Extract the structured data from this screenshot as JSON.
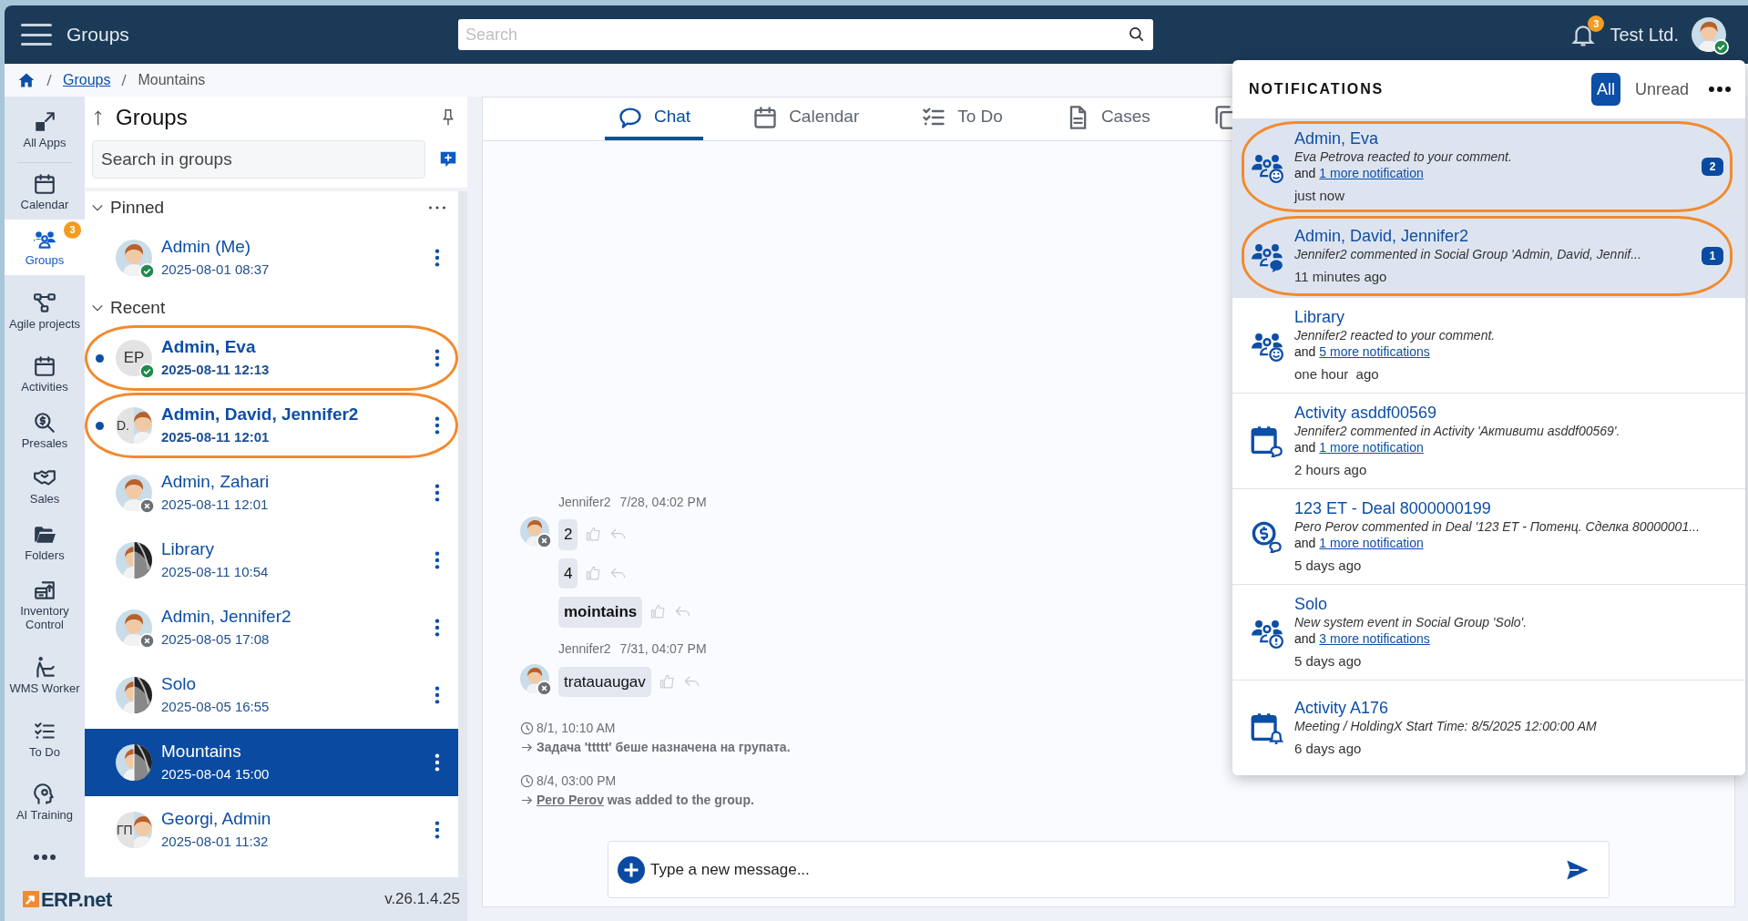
{
  "app_bar": {
    "title": "Groups",
    "search_placeholder": "Search",
    "notification_count": "3",
    "company": "Test Ltd.",
    "user_online": true
  },
  "breadcrumb": [
    {
      "kind": "home"
    },
    {
      "kind": "link",
      "label": "Groups"
    },
    {
      "kind": "current",
      "label": "Mountains"
    }
  ],
  "nav": [
    {
      "kind": "apps",
      "label": "All Apps",
      "selected": false
    },
    {
      "kind": "calendar",
      "label": "Calendar",
      "selected": false
    },
    {
      "kind": "groups",
      "label": "Groups",
      "selected": true,
      "badge": "3"
    },
    {
      "kind": "agile",
      "label": "Agile projects",
      "selected": false
    },
    {
      "kind": "calendar",
      "label": "Activities",
      "selected": false
    },
    {
      "kind": "presales",
      "label": "Presales",
      "selected": false
    },
    {
      "kind": "handshake",
      "label": "Sales",
      "selected": false
    },
    {
      "kind": "folder",
      "label": "Folders",
      "selected": false
    },
    {
      "kind": "inventory",
      "label": "Inventory Control",
      "selected": false
    },
    {
      "kind": "worker",
      "label": "WMS Worker",
      "selected": false
    },
    {
      "kind": "todo",
      "label": "To Do",
      "selected": false
    },
    {
      "kind": "ai",
      "label": "AI Training",
      "selected": false
    },
    {
      "kind": "more",
      "selected": false
    }
  ],
  "footer": {
    "logo": "ERP.net",
    "version": "v.26.1.4.25"
  },
  "groups_panel": {
    "title": "Groups",
    "search_placeholder": "Search in groups",
    "sections": [
      {
        "label": "Pinned",
        "expanded": true,
        "menu": true,
        "items": [
          {
            "name": "Admin (Me)",
            "time": "2025-08-01 08:37",
            "unread": false,
            "selected": false,
            "circled": false,
            "avatar": {
              "kind": "photo",
              "online": true
            }
          }
        ]
      },
      {
        "label": "Recent",
        "expanded": true,
        "items": [
          {
            "name": "Admin, Eva",
            "time": "2025-08-11 12:13",
            "unread": true,
            "selected": false,
            "circled": true,
            "avatar": {
              "kind": "initials",
              "initials": "EP",
              "online": true
            }
          },
          {
            "name": "Admin, David, Jennifer2",
            "time": "2025-08-11 12:01",
            "unread": true,
            "selected": false,
            "circled": true,
            "avatar": {
              "kind": "initials_photo",
              "initials": "D."
            }
          },
          {
            "name": "Admin, Zahari",
            "time": "2025-08-11 12:01",
            "unread": false,
            "selected": false,
            "circled": false,
            "avatar": {
              "kind": "photo",
              "online": false
            }
          },
          {
            "name": "Library",
            "time": "2025-08-11 10:54",
            "unread": false,
            "selected": false,
            "circled": false,
            "avatar": {
              "kind": "photo_pair"
            }
          },
          {
            "name": "Admin, Jennifer2",
            "time": "2025-08-05 17:08",
            "unread": false,
            "selected": false,
            "circled": false,
            "avatar": {
              "kind": "photo",
              "online": false
            }
          },
          {
            "name": "Solo",
            "time": "2025-08-05 16:55",
            "unread": false,
            "selected": false,
            "circled": false,
            "avatar": {
              "kind": "photo_pair"
            }
          },
          {
            "name": "Mountains",
            "time": "2025-08-04 15:00",
            "unread": false,
            "selected": true,
            "circled": false,
            "avatar": {
              "kind": "photo_pair"
            }
          },
          {
            "name": "Georgi, Admin",
            "time": "2025-08-01 11:32",
            "unread": false,
            "selected": false,
            "circled": false,
            "avatar": {
              "kind": "initials_photo",
              "initials": "ГП"
            }
          }
        ]
      }
    ]
  },
  "tabs": [
    {
      "kind": "chat",
      "label": "Chat",
      "selected": true
    },
    {
      "kind": "calendar",
      "label": "Calendar",
      "selected": false
    },
    {
      "kind": "todo",
      "label": "To Do",
      "selected": false
    },
    {
      "kind": "cases",
      "label": "Cases",
      "selected": false
    },
    {
      "kind": "copy",
      "selected": false
    }
  ],
  "chat": {
    "threads": [
      {
        "author": "Jennifer2",
        "time": "7/28, 04:02 PM",
        "online": false,
        "messages": [
          {
            "text": "2",
            "bold": false
          },
          {
            "text": "4",
            "bold": false
          },
          {
            "text": "mointains",
            "bold": true
          }
        ]
      },
      {
        "author": "Jennifer2",
        "time": "7/31, 04:07 PM",
        "online": false,
        "messages": [
          {
            "text": "tratauaugav",
            "bold": false
          }
        ]
      }
    ],
    "events": [
      {
        "time": "8/1, 10:10 AM",
        "text": "Задача 'ttttt' беше назначена на групата."
      },
      {
        "time": "8/4, 03:00 PM",
        "link": "Pero Perov",
        "text": "was added to the group."
      }
    ],
    "input_placeholder": "Type a new message..."
  },
  "notifications": {
    "title": "NOTIFICATIONS",
    "filters": [
      {
        "label": "All",
        "selected": true
      },
      {
        "label": "Unread",
        "selected": false
      }
    ],
    "items": [
      {
        "kind": "group_smile",
        "title": "Admin, Eva",
        "message": "Eva Petrova reacted to your comment.",
        "more_prefix": "and",
        "more_link": "1 more notification",
        "time": "just now",
        "count": "2",
        "unread": true,
        "circled": true
      },
      {
        "kind": "group_chat",
        "title": "Admin, David, Jennifer2",
        "message": "Jennifer2 commented in Social Group 'Admin, David, Jennif...",
        "time": "11 minutes ago",
        "count": "1",
        "unread": true,
        "circled": true
      },
      {
        "kind": "group_smile",
        "title": "Library",
        "message": "Jennifer2 reacted to your comment.",
        "more_prefix": "and",
        "more_link": "5 more notifications",
        "time": "one hour  ago",
        "unread": false,
        "circled": false
      },
      {
        "kind": "calendar_chat",
        "title": "Activity  asddf00569",
        "message": "Jennifer2 commented in Activity 'Активити asddf00569'.",
        "more_prefix": "and",
        "more_link": "1 more notification",
        "time": "2 hours ago",
        "unread": false,
        "circled": false
      },
      {
        "kind": "deal_chat",
        "title": "123 ET - Deal 8000000199",
        "message": "Pero Perov commented in Deal '123 ET - Потенц. Сделка 80000001...",
        "more_prefix": "and",
        "more_link": "1 more notification",
        "time": "5 days ago",
        "unread": false,
        "circled": false
      },
      {
        "kind": "group_alert",
        "title": "Solo",
        "message": "New system event in Social Group 'Solo'.",
        "more_prefix": "and",
        "more_link": "3 more notifications",
        "time": "5 days ago",
        "unread": false,
        "circled": false
      },
      {
        "kind": "calendar_bell",
        "title": "Activity A176",
        "message": "Meeting / HoldingX Start Time: 8/5/2025 12:00:00 AM",
        "time": "6 days ago",
        "unread": false,
        "circled": false
      }
    ]
  }
}
